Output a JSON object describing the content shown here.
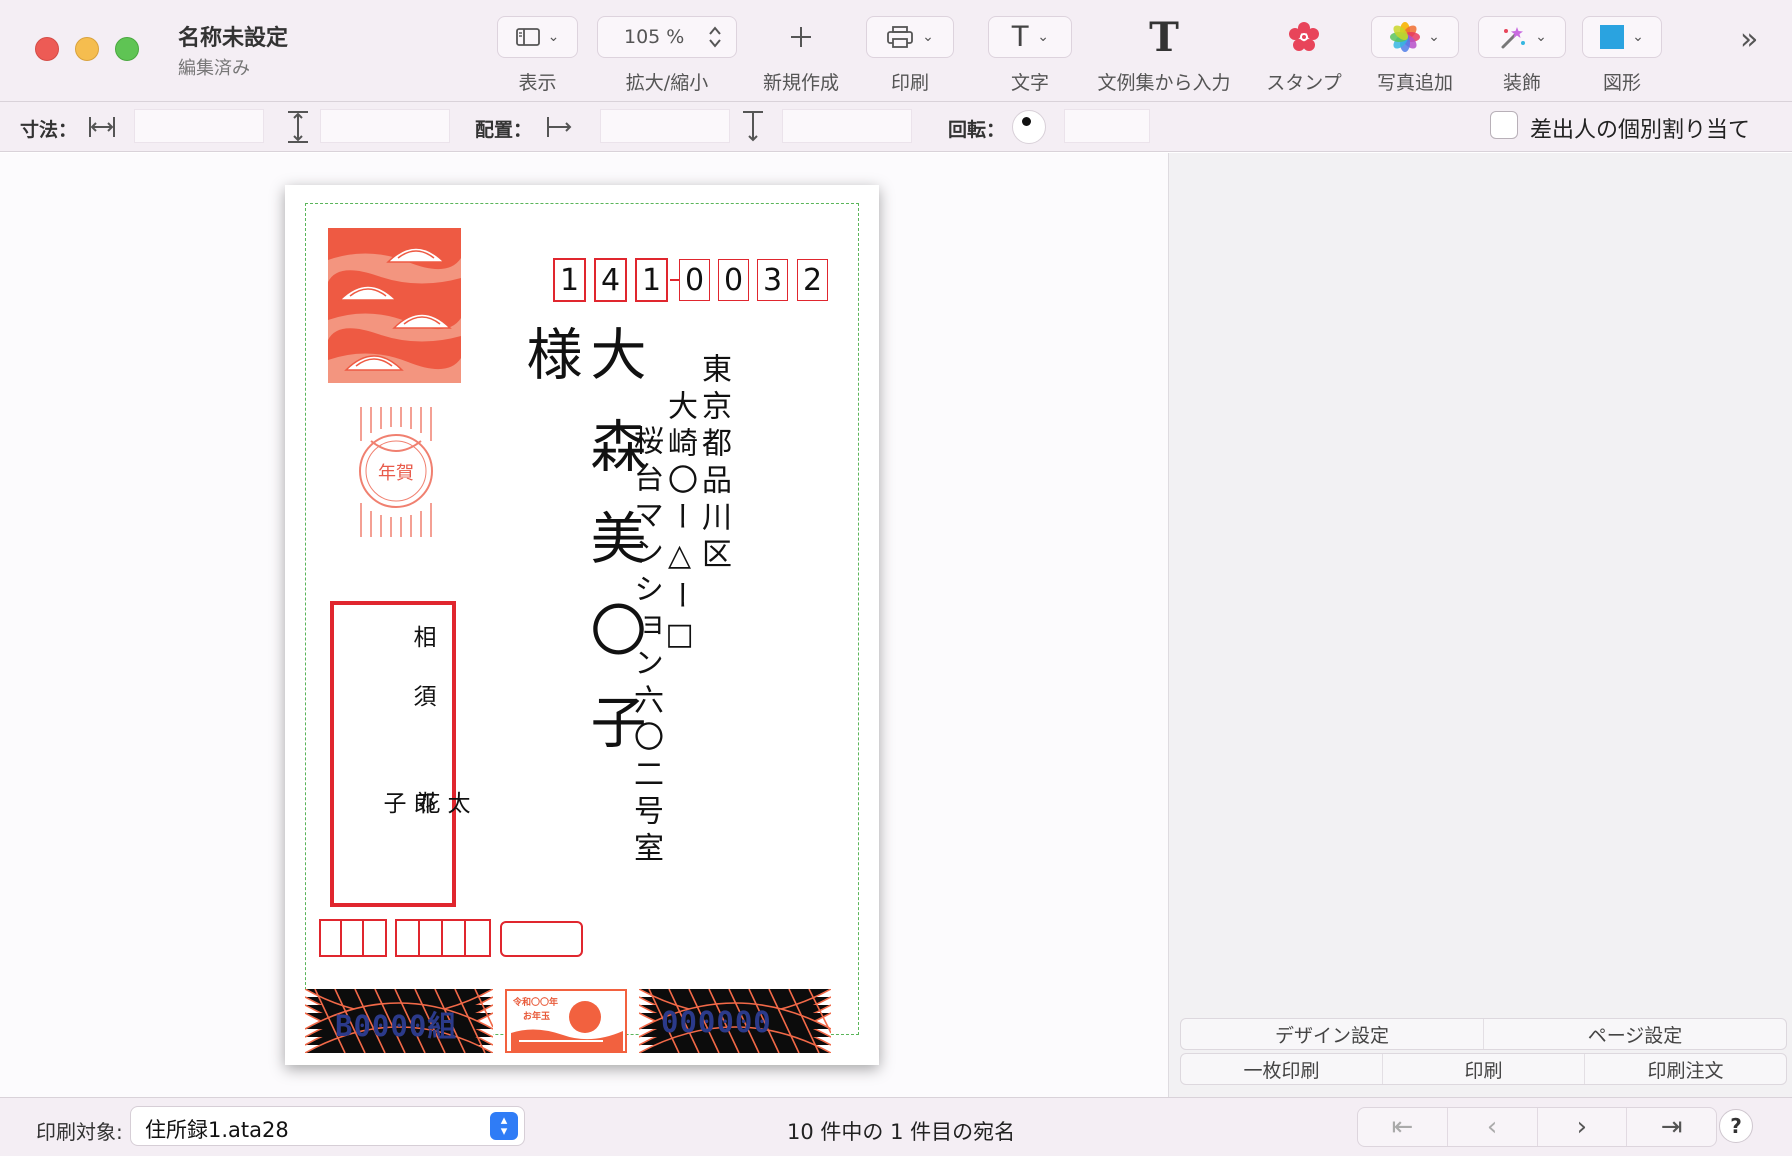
{
  "window": {
    "title": "名称未設定",
    "subtitle": "編集済み"
  },
  "toolbar": {
    "view_label": "表示",
    "zoom_value": "105 %",
    "zoom_label": "拡大/縮小",
    "new_label": "新規作成",
    "print_label": "印刷",
    "text_label": "文字",
    "phrases_label": "文例集から入力",
    "stamp_label": "スタンプ",
    "photo_label": "写真追加",
    "decor_label": "装飾",
    "shape_label": "図形",
    "shape_color": "#2aa3e0",
    "stamp_color": "#e8445a"
  },
  "props": {
    "size_label": "寸法：",
    "position_label": "配置：",
    "rotation_label": "回転：",
    "per_sender_label": "差出人の個別割り当て",
    "per_sender_checked": false
  },
  "postcard": {
    "zip_digits": [
      "1",
      "4",
      "1",
      "0",
      "0",
      "3",
      "2"
    ],
    "recipient_name": "大森美〇子様",
    "address_line1": "東京都品川区",
    "address_line2": "大崎〇ー△ー□",
    "address_line3": "桜台マンション六〇二号室",
    "sender_line1": "相須",
    "sender_line2": "太郎",
    "sender_line3": "花子",
    "nenga_text": "年賀",
    "lottery_group": "B0000組",
    "lottery_number": "000000",
    "era_text_top": "令和〇〇年",
    "era_text_bottom": "お年玉",
    "accent_red": "#e0262e",
    "stamp_orange": "#ee5a43",
    "guide_green": "#5ab55a"
  },
  "right_panel": {
    "design_settings": "デザイン設定",
    "page_settings": "ページ設定",
    "print_single": "一枚印刷",
    "print": "印刷",
    "print_order": "印刷注文"
  },
  "status": {
    "print_target_label": "印刷対象:",
    "print_target_value": "住所録1.ata28",
    "record_count": "10 件中の 1 件目の宛名",
    "help": "?"
  }
}
